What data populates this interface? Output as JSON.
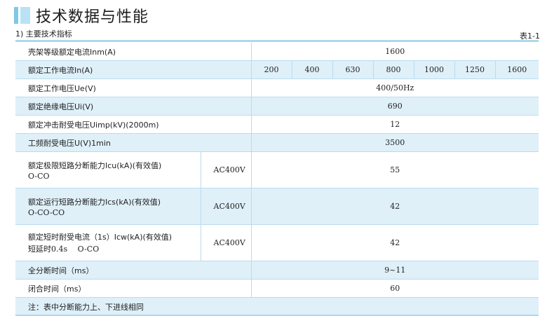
{
  "header": {
    "title": "技术数据与性能"
  },
  "subtitle": "1) 主要技术指标",
  "table_no": "表1-1",
  "rows": {
    "frame_current": {
      "label": "壳架等级额定电流Inm(A)",
      "value": "1600"
    },
    "rated_current": {
      "label": "额定工作电流In(A)",
      "values": [
        "200",
        "400",
        "630",
        "800",
        "1000",
        "1250",
        "1600"
      ]
    },
    "rated_voltage": {
      "label": "额定工作电压Ue(V)",
      "value": "400/50Hz"
    },
    "insulation_voltage": {
      "label": "额定绝缘电压Ui(V)",
      "value": "690"
    },
    "impulse_voltage": {
      "label": "额定冲击耐受电压Uimp(kV)(2000m)",
      "value": "12"
    },
    "power_freq_voltage": {
      "label": "工频耐受电压U(V)1min",
      "value": "3500"
    },
    "icu": {
      "label": "额定极限短路分断能力Icu(kA)(有效值)",
      "sub": "O-CO",
      "voltage": "AC400V",
      "value": "55"
    },
    "ics": {
      "label": "额定运行短路分断能力Ics(kA)(有效值)",
      "sub": "O-CO-CO",
      "voltage": "AC400V",
      "value": "42"
    },
    "icw": {
      "label": "额定短时耐受电流（1s）Icw(kA)(有效值)",
      "sub": "短延时0.4s　 O-CO",
      "voltage": "AC400V",
      "value": "42"
    },
    "break_time": {
      "label": "全分断时间（ms）",
      "value": "9~11"
    },
    "close_time": {
      "label": "闭合时间（ms）",
      "value": "60"
    }
  },
  "note": "注：表中分断能力上、下进线相同"
}
